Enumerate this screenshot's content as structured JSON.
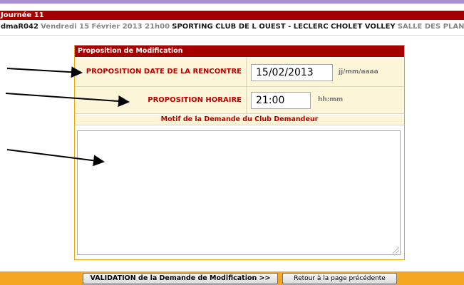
{
  "header": {
    "title": "Journée 11",
    "match_code": "dmaR042",
    "match_date": "Vendredi 15 Février 2013 21h00",
    "match_teams": "SPORTING CLUB DE L OUEST - LECLERC CHOLET VOLLEY",
    "venue": "SALLE DES PLANTES"
  },
  "form": {
    "title": "Proposition de Modification",
    "date_label": "PROPOSITION DATE DE LA RENCONTRE",
    "date_value": "15/02/2013",
    "date_format": "jj/mm/aaaa",
    "time_label": "PROPOSITION HORAIRE",
    "time_value": "21:00",
    "time_format": "hh:mm",
    "motif_label": "Motif de la Demande du Club Demandeur",
    "motif_value": ""
  },
  "actions": {
    "validate_label": "VALIDATION de la Demande de Modification >>",
    "back_label": "Retour à la page précédente"
  },
  "colors": {
    "header_red": "#a50000",
    "label_red": "#c00000",
    "row_bg": "#fdf5d8",
    "border_orange": "#f0a800",
    "bottom_bar": "#f5a623"
  }
}
